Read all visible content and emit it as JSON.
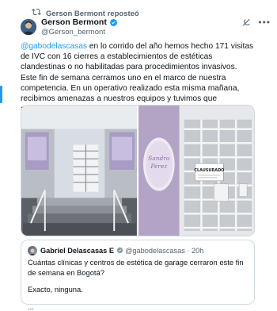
{
  "repost": {
    "text": "Gerson Bermont reposteó"
  },
  "author": {
    "name": "Gerson Bermont",
    "handle": "@Gerson_bermont"
  },
  "post": {
    "mention": "@gabodelascasas",
    "text": " en lo corrido del año hemos hecho 171 visitas de IVC con 16 cierres a establecimientos de estéticas clandestinas o no habilitadas para procedimientos invasivos. Este fin de semana cerramos uno en el marco de nuestra competencia. En un operativo realizado esta misma mañana, recibimos amenazas a nuestros equipos y tuvimos que apoyarnos con la Sijín."
  },
  "media": {
    "photo1_icon": "stairs-doorway-photo",
    "photo2_icon": "closed-storefront-photo",
    "sign_text": "CLAUSURADO",
    "storefront_text": "Sandra Pérez"
  },
  "quote": {
    "name": "Gabriel Delascasas E",
    "handle": "@gabodelascasas",
    "time": "20h",
    "line1": "Cuántas clínicas y centros de estética de garage cerraron este fin de semana en Bogotá?",
    "line2": "Exacto, ninguna.",
    "line3": "..."
  },
  "colors": {
    "accent": "#1d9bf0",
    "text": "#0f1419",
    "muted": "#536471",
    "border": "#cfd9de"
  }
}
